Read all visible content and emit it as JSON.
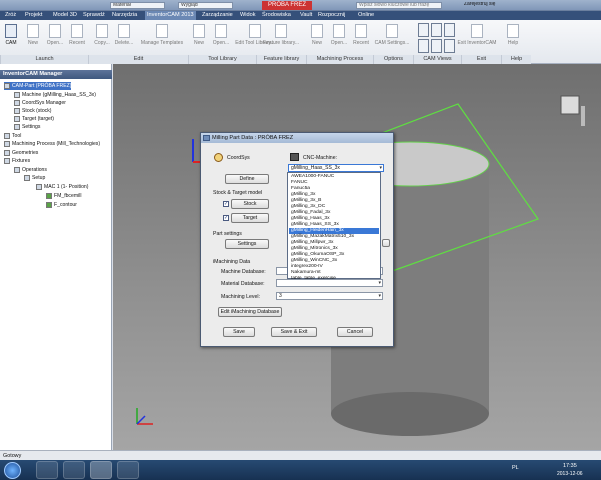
{
  "titlebar": {
    "field1": "Materiał",
    "field2": "Wygląd",
    "app_title": "PRÓBA FREZ",
    "search_placeholder": "Wpisz słowo kluczowe lub frazę",
    "signin": "Zarejestruj się"
  },
  "menus": [
    "Zróż",
    "Projekt",
    "Model 3D",
    "Sprawdź",
    "Narzędzia",
    "InventorCAM 2013",
    "Zarządzanie",
    "Widok",
    "Środowiska",
    "Vault",
    "Rozpocznij",
    "Online"
  ],
  "ribbon": {
    "buttons": [
      "CAM",
      "New",
      "Open...",
      "Recent",
      "Copy...",
      "Delete...",
      "Manage Templates",
      "New",
      "Open...",
      "Edit Tool Library...",
      "Feature library...",
      "New",
      "Open...",
      "Recent",
      "CAM Settings...",
      "Exit InventorCAM",
      "Help"
    ],
    "panels": [
      "Launch",
      "Edit",
      "Tool Library",
      "Feature library",
      "Machining Process",
      "Options",
      "CAM Views",
      "Exit",
      "Help"
    ]
  },
  "tree": {
    "header": "InventorCAM Manager",
    "items": [
      "CAM-Part (PRÓBA FREZ)",
      "Machine (gMilling_Haas_SS_3x)",
      "CoordSys Manager",
      "Stock (stock)",
      "Target (target)",
      "Settings",
      "Tool",
      "Machining Process (Mill_Technologies)",
      "Geometries",
      "Fixtures",
      "Operations",
      "Setup",
      "MAC 1 (1- Position)",
      "FM_fbcemill",
      "F_contour"
    ]
  },
  "dialog": {
    "title": "Milling Part Data : PRÓBA FREZ",
    "coordsys_label": "CoordSys",
    "define_btn": "Define",
    "stock_target_label": "Stock & Target model",
    "stock_btn": "Stock",
    "target_btn": "Target",
    "part_settings_label": "Part settings",
    "settings_btn": "Settings",
    "cnc_label": "CNC-Machine:",
    "cnc_value": "gMilling_Haas_SS_3x",
    "imachining_label": "iMachining Data",
    "machine_db_label": "Machine Database:",
    "material_db_label": "Material Database:",
    "machining_level_label": "Machining Level:",
    "machining_level_value": "3",
    "edit_imachining_btn": "Edit iMachining Database",
    "save_btn": "Save",
    "save_exit_btn": "Save & Exit",
    "cancel_btn": "Cancel",
    "machine_options": [
      "AWEA1000-FANUC",
      "FANUC",
      "Fanuc5a",
      "gMilling_3x",
      "gMilling_3x_B",
      "gMilling_3x_DC",
      "gMilling_Fadal_3x",
      "gMilling_Haas_3x",
      "gMilling_Haas_SS_3x",
      "gMilling_HeidenHain_3x",
      "gMilling_MazakMatrix510_3x",
      "gMilling_Millpwr_3x",
      "gMilling_Mitronics_3x",
      "gMilling_OkumaOSP_3x",
      "gMilling_WinCNC_3x",
      "integrex200-IV",
      "Nakamura-mt",
      "table_table_exercise"
    ],
    "highlighted_index": 9
  },
  "status": {
    "text": "Gotowy"
  },
  "tray": {
    "lang": "PL",
    "time": "17:35",
    "date": "2013-12-06"
  }
}
